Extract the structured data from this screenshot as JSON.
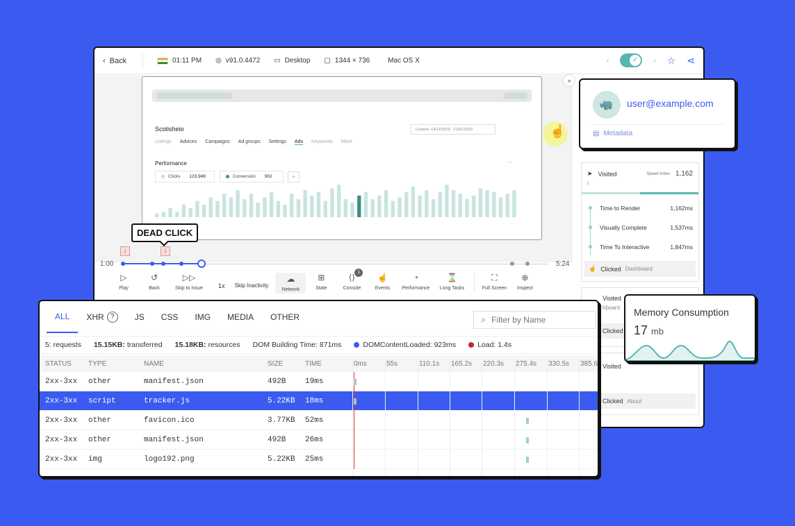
{
  "topbar": {
    "back": "Back",
    "time": "01:11 PM",
    "browser": "v91.0.4472",
    "device": "Desktop",
    "resolution": "1344 × 736",
    "os": "Mac OS X"
  },
  "site": {
    "title": "Scotisheio",
    "tabs": [
      "Listings",
      "Advices",
      "Campaigns",
      "Ad groups",
      "Settings",
      "Ads",
      "Keywords",
      "More"
    ],
    "date_range": "Custom: 14/12/2019 - 21/01/2020",
    "performance_label": "Performance",
    "clicks_label": "Clicks",
    "clicks_value": "123,949",
    "conversion_label": "Conversion",
    "conversion_value": "902",
    "bars": [
      4,
      6,
      10,
      6,
      14,
      10,
      18,
      14,
      22,
      18,
      26,
      22,
      30,
      20,
      26,
      16,
      22,
      28,
      18,
      14,
      26,
      20,
      30,
      24,
      28,
      18,
      32,
      36,
      20,
      16,
      24,
      28,
      20,
      24,
      30,
      18,
      22,
      28,
      34,
      24,
      30,
      20,
      28,
      36,
      30,
      26,
      20,
      24,
      32,
      30,
      28,
      22,
      26,
      30
    ]
  },
  "timeline": {
    "start": "1:00",
    "end": "5:24",
    "dead_click": "DEAD CLICK"
  },
  "controls": [
    {
      "label": "Play",
      "icon": "play-icon"
    },
    {
      "label": "Back",
      "icon": "rewind-icon"
    },
    {
      "label": "Skip to Issue",
      "icon": "skip-icon"
    },
    {
      "label": "1x"
    },
    {
      "label": "Skip Inactivity"
    },
    {
      "label": "Network",
      "icon": "cloud-download-icon"
    },
    {
      "label": "State",
      "icon": "grid-icon"
    },
    {
      "label": "Console",
      "icon": "code-icon",
      "badge": "1"
    },
    {
      "label": "Events",
      "icon": "pointer-icon"
    },
    {
      "label": "Performance",
      "icon": "gauge-icon"
    },
    {
      "label": "Long Tasks",
      "icon": "hourglass-icon"
    },
    {
      "label": "Full Screen",
      "icon": "fullscreen-icon"
    },
    {
      "label": "Inspect",
      "icon": "crosshair-icon"
    }
  ],
  "user": {
    "email": "user@example.com",
    "metadata": "Metadata"
  },
  "sidebar": {
    "visited": "Visited",
    "path": "/",
    "speed_index_label": "Speed Index",
    "speed_index_value": "1,162",
    "metrics": [
      {
        "label": "Time to Render",
        "value": "1,162ms"
      },
      {
        "label": "Visually Complete",
        "value": "1,537ms"
      },
      {
        "label": "Time To Interactive",
        "value": "1,847ms"
      }
    ],
    "clicked": "Clicked",
    "clicked_page": "Dashboard",
    "visited2": "Visited",
    "partial_page": "hboard",
    "clicked2": "Clicked",
    "visited3": "Visited",
    "clicked3": "Clicked",
    "clicked3_page": "About"
  },
  "network": {
    "tabs": [
      "ALL",
      "XHR",
      "JS",
      "CSS",
      "IMG",
      "MEDIA",
      "OTHER"
    ],
    "filter_placeholder": "Filter by Name",
    "requests": "5: requests",
    "transferred_value": "15.15KB:",
    "transferred_label": "transferred",
    "resources_value": "15.18KB:",
    "resources_label": "resources",
    "dom_label": "DOM Building Time:",
    "dom_value": "871ms",
    "dcl_label": "DOMContentLoaded:",
    "dcl_value": "923ms",
    "load_label": "Load:",
    "load_value": "1.4s",
    "columns": [
      "STATUS",
      "TYPE",
      "NAME",
      "SIZE",
      "TIME"
    ],
    "waterfall_ticks": [
      "0ms",
      "55s",
      "110.1s",
      "165.2s",
      "220.3s",
      "275.4s",
      "330.5s",
      "385.6"
    ],
    "rows": [
      {
        "status": "2xx-3xx",
        "type": "other",
        "name": "manifest.json",
        "size": "492B",
        "time": "19ms"
      },
      {
        "status": "2xx-3xx",
        "type": "script",
        "name": "tracker.js",
        "size": "5.22KB",
        "time": "18ms"
      },
      {
        "status": "2xx-3xx",
        "type": "other",
        "name": "favicon.ico",
        "size": "3.77KB",
        "time": "52ms"
      },
      {
        "status": "2xx-3xx",
        "type": "other",
        "name": "manifest.json",
        "size": "492B",
        "time": "26ms"
      },
      {
        "status": "2xx-3xx",
        "type": "img",
        "name": "logo192.png",
        "size": "5.22KB",
        "time": "25ms"
      }
    ]
  },
  "memory": {
    "title": "Memory Consumption",
    "value": "17",
    "unit": "mb"
  },
  "colors": {
    "background": "#3b5bf0",
    "accent": "#3b5bf0",
    "teal": "#58b7ad",
    "dcl_dot": "#3b5bf0",
    "load_dot": "#c0282d"
  }
}
